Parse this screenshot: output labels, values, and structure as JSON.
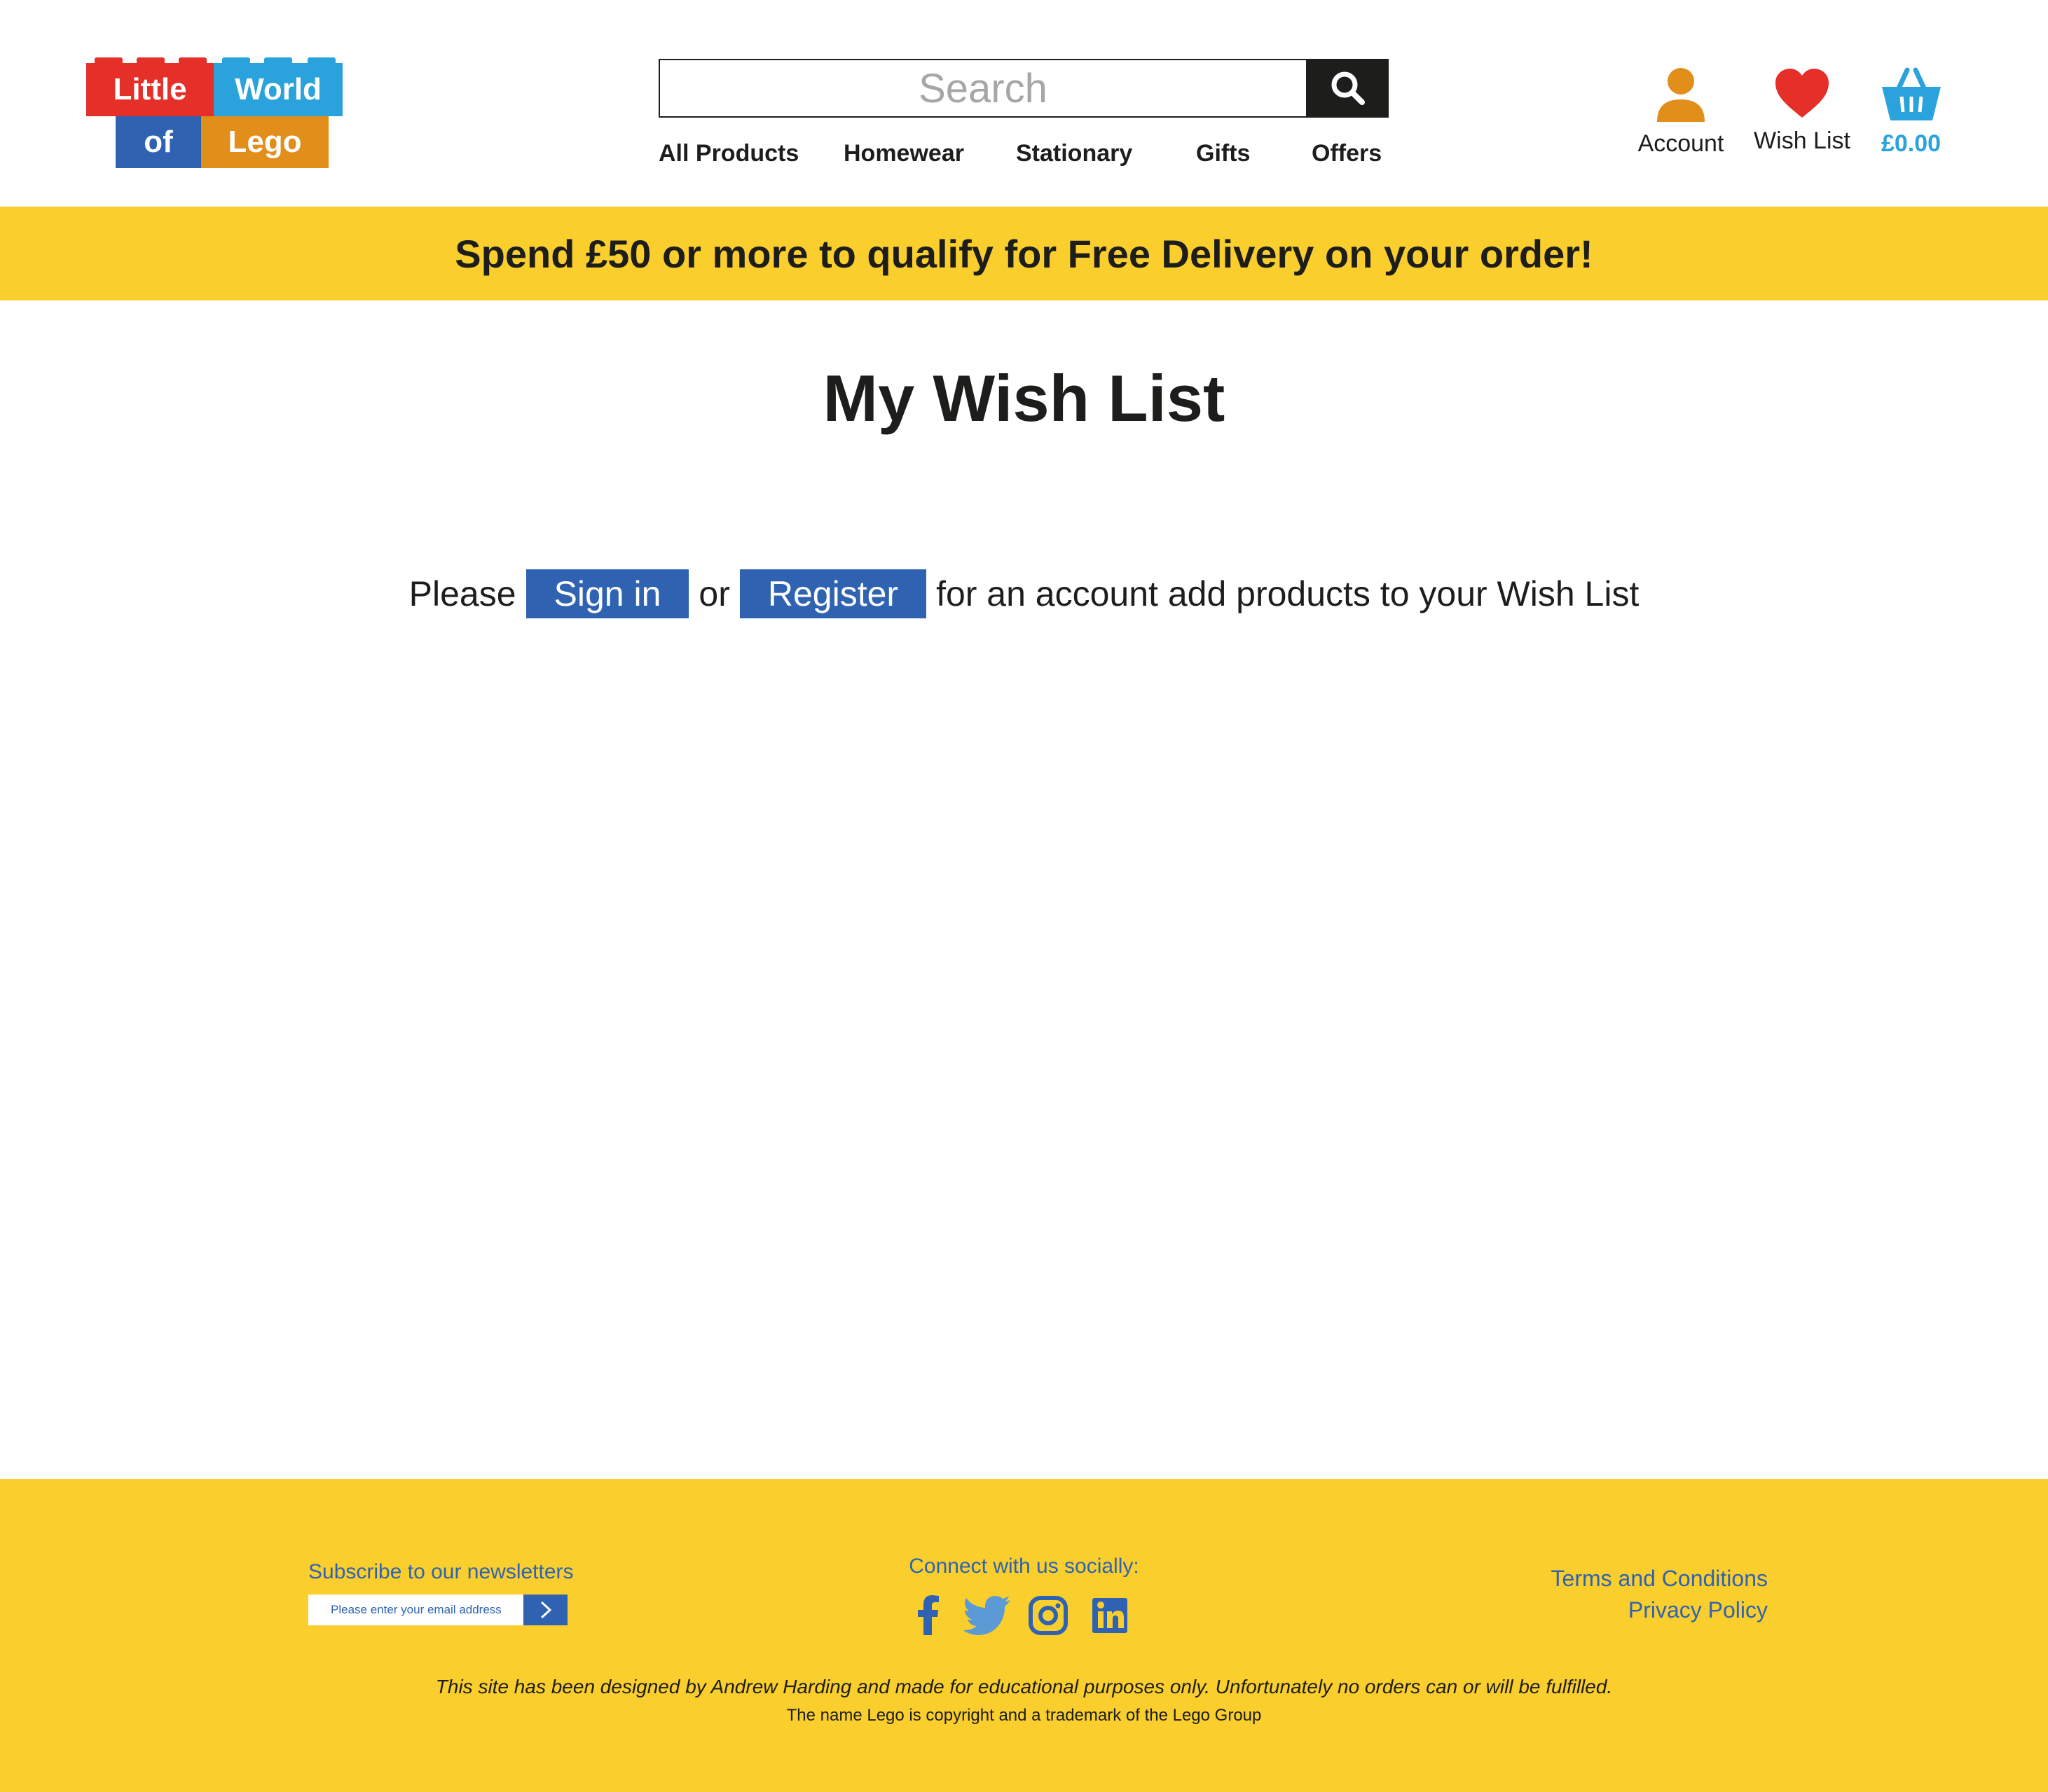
{
  "logo": {
    "words": [
      "Little",
      "World",
      "of",
      "Lego"
    ]
  },
  "search": {
    "placeholder": "Search"
  },
  "nav": {
    "items": [
      "All Products",
      "Homewear",
      "Stationary",
      "Gifts",
      "Offers"
    ]
  },
  "header_icons": {
    "account_label": "Account",
    "wishlist_label": "Wish List",
    "basket_total": "£0.00"
  },
  "promo": {
    "text": "Spend £50 or more to qualify for Free Delivery on your order!"
  },
  "main": {
    "title": "My Wish List",
    "prompt_before": "Please",
    "sign_in_label": "Sign in",
    "prompt_or": "or",
    "register_label": "Register",
    "prompt_after": "for an account add products to your Wish List"
  },
  "footer": {
    "newsletter_title": "Subscribe to our newsletters",
    "newsletter_placeholder": "Please enter your email address",
    "social_title": "Connect with us socially:",
    "social_icons": [
      "facebook-icon",
      "twitter-icon",
      "instagram-icon",
      "linkedin-icon"
    ],
    "terms_label": "Terms and Conditions",
    "privacy_label": "Privacy Policy",
    "disclaimer": "This site has been designed by Andrew Harding and made for educational purposes only. Unfortunately no orders can or will be fulfilled.",
    "copyright": "The name Lego is copyright and a trademark of the Lego Group"
  },
  "colors": {
    "yellow": "#f9ce2d",
    "blue": "#2f63b1",
    "light_blue": "#2aa3dc",
    "red": "#e5302a",
    "orange": "#e28e1b",
    "dark": "#1d1d1b"
  }
}
